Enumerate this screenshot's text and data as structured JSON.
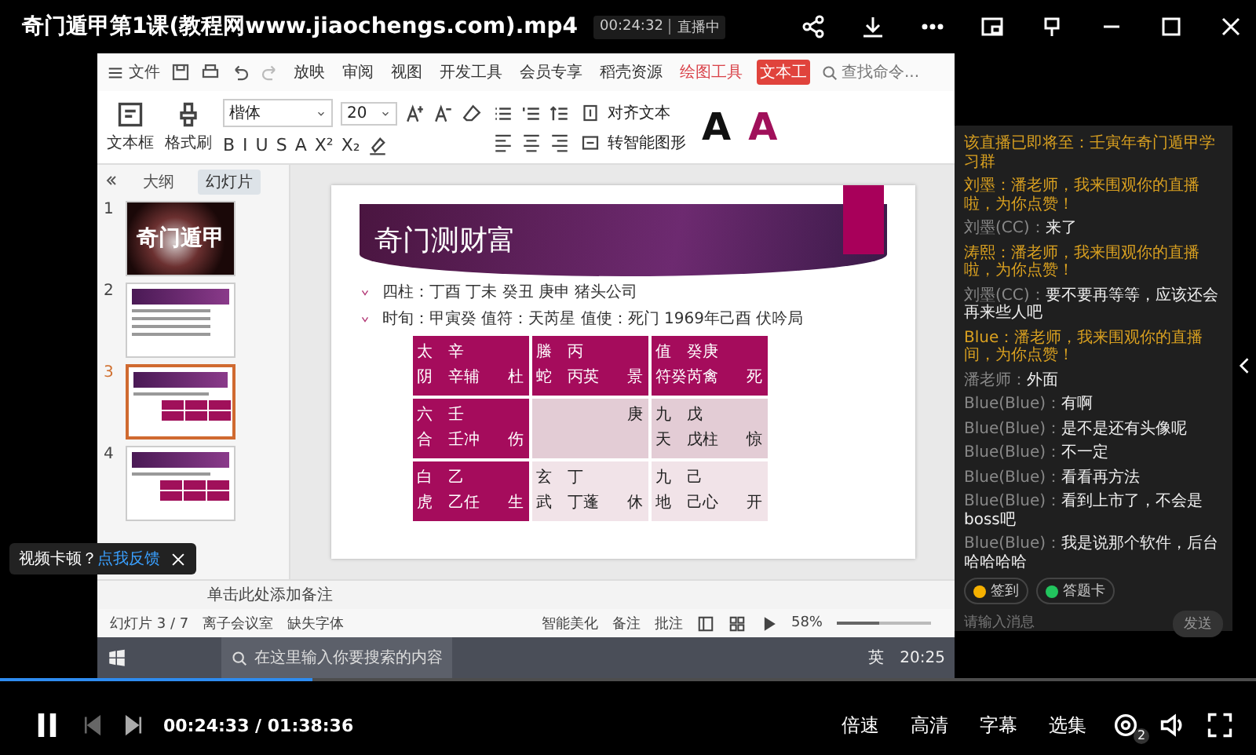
{
  "player": {
    "title": "奇门遁甲第1课(教程网www.jiaochengs.com).mp4",
    "time": "00:24:33 / 01:38:36",
    "level": 0.249,
    "controls": [
      "倍速",
      "高清",
      "字幕",
      "选集"
    ],
    "badge": "2",
    "feedback": {
      "text": "视频卡顿？",
      "link": "点我反馈"
    }
  },
  "live": {
    "time": "00:24:32",
    "status": "直播中"
  },
  "wps": {
    "file_menu": "文件",
    "tabs": [
      {
        "label": "放映",
        "kind": "plain",
        "selected": false
      },
      {
        "label": "审阅",
        "kind": "plain",
        "selected": false
      },
      {
        "label": "视图",
        "kind": "plain",
        "selected": false
      },
      {
        "label": "开发工具",
        "kind": "plain",
        "selected": false
      },
      {
        "label": "会员专享",
        "kind": "plain",
        "selected": false
      },
      {
        "label": "稻壳资源",
        "kind": "plain",
        "selected": false
      },
      {
        "label": "绘图工具",
        "kind": "context",
        "selected": false
      },
      {
        "label": "文本工",
        "kind": "context",
        "selected": true
      }
    ],
    "search": {
      "placeholder": "查找命令..."
    },
    "ribbon": {
      "text_box": "文本框",
      "format_painter": "格式刷",
      "font": "楷体",
      "size": "20",
      "format": [
        "B",
        "I",
        "U",
        "S",
        "A",
        "X²",
        "X₂"
      ],
      "align_text": "对齐文本",
      "smart_art": "转智能图形",
      "styles": [
        {
          "label": "A",
          "color": "#111111"
        },
        {
          "label": "A",
          "color": "#a0105a"
        }
      ]
    },
    "panel_tabs": [
      {
        "label": "大纲",
        "selected": false
      },
      {
        "label": "幻灯片",
        "selected": true
      }
    ],
    "slides": [
      {
        "number": "1",
        "kind": "cover",
        "title": "奇门遁甲",
        "selected": false
      },
      {
        "number": "2",
        "kind": "text",
        "selected": false
      },
      {
        "number": "3",
        "kind": "table",
        "selected": true
      },
      {
        "number": "4",
        "kind": "table",
        "selected": false
      }
    ],
    "slide": {
      "title": "奇门测财富",
      "bullets": [
        "四柱：丁酉 丁未 癸丑 庚申 猪头公司",
        "时旬：甲寅癸 值符：天芮星 值使：死门 1969年己酉 伏吟局"
      ],
      "table": [
        [
          {
            "kind": "dark",
            "lines": [
              [
                "太",
                "辛"
              ],
              [
                "阴",
                "辛辅",
                "杜"
              ]
            ]
          },
          {
            "kind": "dark",
            "lines": [
              [
                "螣",
                "丙"
              ],
              [
                "蛇",
                "丙英",
                "景"
              ]
            ]
          },
          {
            "kind": "dark",
            "lines": [
              [
                "值",
                "癸庚"
              ],
              [
                "符癸芮禽",
                "死"
              ]
            ]
          }
        ],
        [
          {
            "kind": "dark",
            "lines": [
              [
                "六",
                "壬"
              ],
              [
                "合",
                "壬冲",
                "伤"
              ]
            ]
          },
          {
            "kind": "light",
            "lines": [
              [
                "庚"
              ]
            ]
          },
          {
            "kind": "light",
            "lines": [
              [
                "九",
                "戊"
              ],
              [
                "天",
                "戊柱",
                "惊"
              ]
            ]
          }
        ],
        [
          {
            "kind": "dark",
            "lines": [
              [
                "白",
                "乙"
              ],
              [
                "虎",
                "乙任",
                "生"
              ]
            ]
          },
          {
            "kind": "pale",
            "lines": [
              [
                "玄",
                "丁"
              ],
              [
                "武",
                "丁蓬",
                "休"
              ]
            ]
          },
          {
            "kind": "pale",
            "lines": [
              [
                "九",
                "己"
              ],
              [
                "地",
                "己心",
                "开"
              ]
            ]
          }
        ]
      ]
    },
    "notes": "单击此处添加备注",
    "status": {
      "slide": "幻灯片 3 / 7",
      "theme": "离子会议室",
      "missing_font": "缺失字体",
      "beautify": "智能美化",
      "notes": "备注",
      "comments": "批注",
      "zoom": "58%",
      "level": 0.45
    },
    "taskbar": {
      "search": "在这里输入你要搜索的内容",
      "ime": "英",
      "clock": "20:25"
    }
  },
  "chat": {
    "messages": [
      {
        "kind": "notice",
        "text": "该直播已即将至：壬寅年奇门遁甲学习群"
      },
      {
        "kind": "notice",
        "text": "刘墨：潘老师，我来围观你的直播啦，为你点赞！"
      },
      {
        "kind": "chat",
        "name": "刘墨(CC)：",
        "text": "来了"
      },
      {
        "kind": "notice",
        "text": "涛熙：潘老师，我来围观你的直播啦，为你点赞！"
      },
      {
        "kind": "chat",
        "name": "刘墨(CC)：",
        "text": "要不要再等等，应该还会再来些人吧"
      },
      {
        "kind": "notice",
        "text": "Blue：潘老师，我来围观你的直播间，为你点赞！"
      },
      {
        "kind": "chat",
        "name": "潘老师：",
        "text": "外面"
      },
      {
        "kind": "chat",
        "name": "Blue(Blue)：",
        "text": "有啊"
      },
      {
        "kind": "chat",
        "name": "Blue(Blue)：",
        "text": "是不是还有头像呢"
      },
      {
        "kind": "chat",
        "name": "Blue(Blue)：",
        "text": "不一定"
      },
      {
        "kind": "chat",
        "name": "Blue(Blue)：",
        "text": "看看再方法"
      },
      {
        "kind": "chat",
        "name": "Blue(Blue)：",
        "text": "看到上市了，不会是boss吧"
      },
      {
        "kind": "chat",
        "name": "Blue(Blue)：",
        "text": "我是说那个软件，后台哈哈哈哈"
      }
    ],
    "actions": [
      {
        "label": "签到",
        "color": "#f5b000"
      },
      {
        "label": "答题卡",
        "color": "#22c55e"
      }
    ],
    "placeholder": "请输入消息",
    "send": "发送"
  }
}
